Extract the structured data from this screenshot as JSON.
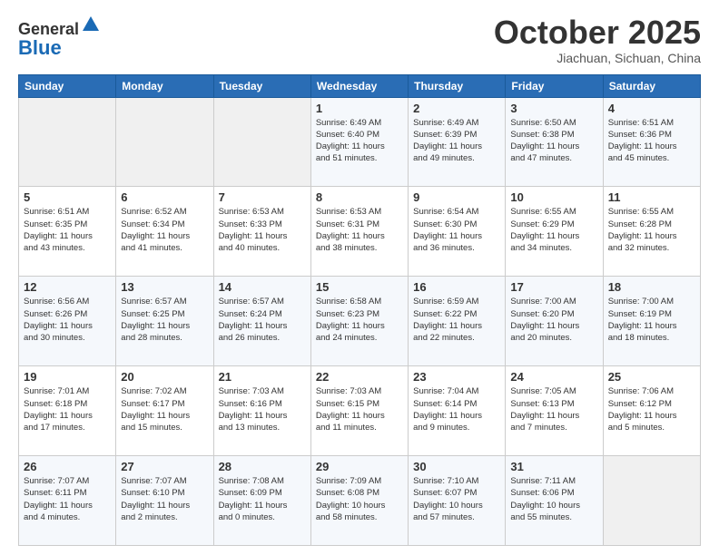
{
  "header": {
    "logo_line1": "General",
    "logo_line2": "Blue",
    "month": "October 2025",
    "location": "Jiachuan, Sichuan, China"
  },
  "days_of_week": [
    "Sunday",
    "Monday",
    "Tuesday",
    "Wednesday",
    "Thursday",
    "Friday",
    "Saturday"
  ],
  "weeks": [
    [
      {
        "day": "",
        "info": ""
      },
      {
        "day": "",
        "info": ""
      },
      {
        "day": "",
        "info": ""
      },
      {
        "day": "1",
        "info": "Sunrise: 6:49 AM\nSunset: 6:40 PM\nDaylight: 11 hours\nand 51 minutes."
      },
      {
        "day": "2",
        "info": "Sunrise: 6:49 AM\nSunset: 6:39 PM\nDaylight: 11 hours\nand 49 minutes."
      },
      {
        "day": "3",
        "info": "Sunrise: 6:50 AM\nSunset: 6:38 PM\nDaylight: 11 hours\nand 47 minutes."
      },
      {
        "day": "4",
        "info": "Sunrise: 6:51 AM\nSunset: 6:36 PM\nDaylight: 11 hours\nand 45 minutes."
      }
    ],
    [
      {
        "day": "5",
        "info": "Sunrise: 6:51 AM\nSunset: 6:35 PM\nDaylight: 11 hours\nand 43 minutes."
      },
      {
        "day": "6",
        "info": "Sunrise: 6:52 AM\nSunset: 6:34 PM\nDaylight: 11 hours\nand 41 minutes."
      },
      {
        "day": "7",
        "info": "Sunrise: 6:53 AM\nSunset: 6:33 PM\nDaylight: 11 hours\nand 40 minutes."
      },
      {
        "day": "8",
        "info": "Sunrise: 6:53 AM\nSunset: 6:31 PM\nDaylight: 11 hours\nand 38 minutes."
      },
      {
        "day": "9",
        "info": "Sunrise: 6:54 AM\nSunset: 6:30 PM\nDaylight: 11 hours\nand 36 minutes."
      },
      {
        "day": "10",
        "info": "Sunrise: 6:55 AM\nSunset: 6:29 PM\nDaylight: 11 hours\nand 34 minutes."
      },
      {
        "day": "11",
        "info": "Sunrise: 6:55 AM\nSunset: 6:28 PM\nDaylight: 11 hours\nand 32 minutes."
      }
    ],
    [
      {
        "day": "12",
        "info": "Sunrise: 6:56 AM\nSunset: 6:26 PM\nDaylight: 11 hours\nand 30 minutes."
      },
      {
        "day": "13",
        "info": "Sunrise: 6:57 AM\nSunset: 6:25 PM\nDaylight: 11 hours\nand 28 minutes."
      },
      {
        "day": "14",
        "info": "Sunrise: 6:57 AM\nSunset: 6:24 PM\nDaylight: 11 hours\nand 26 minutes."
      },
      {
        "day": "15",
        "info": "Sunrise: 6:58 AM\nSunset: 6:23 PM\nDaylight: 11 hours\nand 24 minutes."
      },
      {
        "day": "16",
        "info": "Sunrise: 6:59 AM\nSunset: 6:22 PM\nDaylight: 11 hours\nand 22 minutes."
      },
      {
        "day": "17",
        "info": "Sunrise: 7:00 AM\nSunset: 6:20 PM\nDaylight: 11 hours\nand 20 minutes."
      },
      {
        "day": "18",
        "info": "Sunrise: 7:00 AM\nSunset: 6:19 PM\nDaylight: 11 hours\nand 18 minutes."
      }
    ],
    [
      {
        "day": "19",
        "info": "Sunrise: 7:01 AM\nSunset: 6:18 PM\nDaylight: 11 hours\nand 17 minutes."
      },
      {
        "day": "20",
        "info": "Sunrise: 7:02 AM\nSunset: 6:17 PM\nDaylight: 11 hours\nand 15 minutes."
      },
      {
        "day": "21",
        "info": "Sunrise: 7:03 AM\nSunset: 6:16 PM\nDaylight: 11 hours\nand 13 minutes."
      },
      {
        "day": "22",
        "info": "Sunrise: 7:03 AM\nSunset: 6:15 PM\nDaylight: 11 hours\nand 11 minutes."
      },
      {
        "day": "23",
        "info": "Sunrise: 7:04 AM\nSunset: 6:14 PM\nDaylight: 11 hours\nand 9 minutes."
      },
      {
        "day": "24",
        "info": "Sunrise: 7:05 AM\nSunset: 6:13 PM\nDaylight: 11 hours\nand 7 minutes."
      },
      {
        "day": "25",
        "info": "Sunrise: 7:06 AM\nSunset: 6:12 PM\nDaylight: 11 hours\nand 5 minutes."
      }
    ],
    [
      {
        "day": "26",
        "info": "Sunrise: 7:07 AM\nSunset: 6:11 PM\nDaylight: 11 hours\nand 4 minutes."
      },
      {
        "day": "27",
        "info": "Sunrise: 7:07 AM\nSunset: 6:10 PM\nDaylight: 11 hours\nand 2 minutes."
      },
      {
        "day": "28",
        "info": "Sunrise: 7:08 AM\nSunset: 6:09 PM\nDaylight: 11 hours\nand 0 minutes."
      },
      {
        "day": "29",
        "info": "Sunrise: 7:09 AM\nSunset: 6:08 PM\nDaylight: 10 hours\nand 58 minutes."
      },
      {
        "day": "30",
        "info": "Sunrise: 7:10 AM\nSunset: 6:07 PM\nDaylight: 10 hours\nand 57 minutes."
      },
      {
        "day": "31",
        "info": "Sunrise: 7:11 AM\nSunset: 6:06 PM\nDaylight: 10 hours\nand 55 minutes."
      },
      {
        "day": "",
        "info": ""
      }
    ]
  ]
}
